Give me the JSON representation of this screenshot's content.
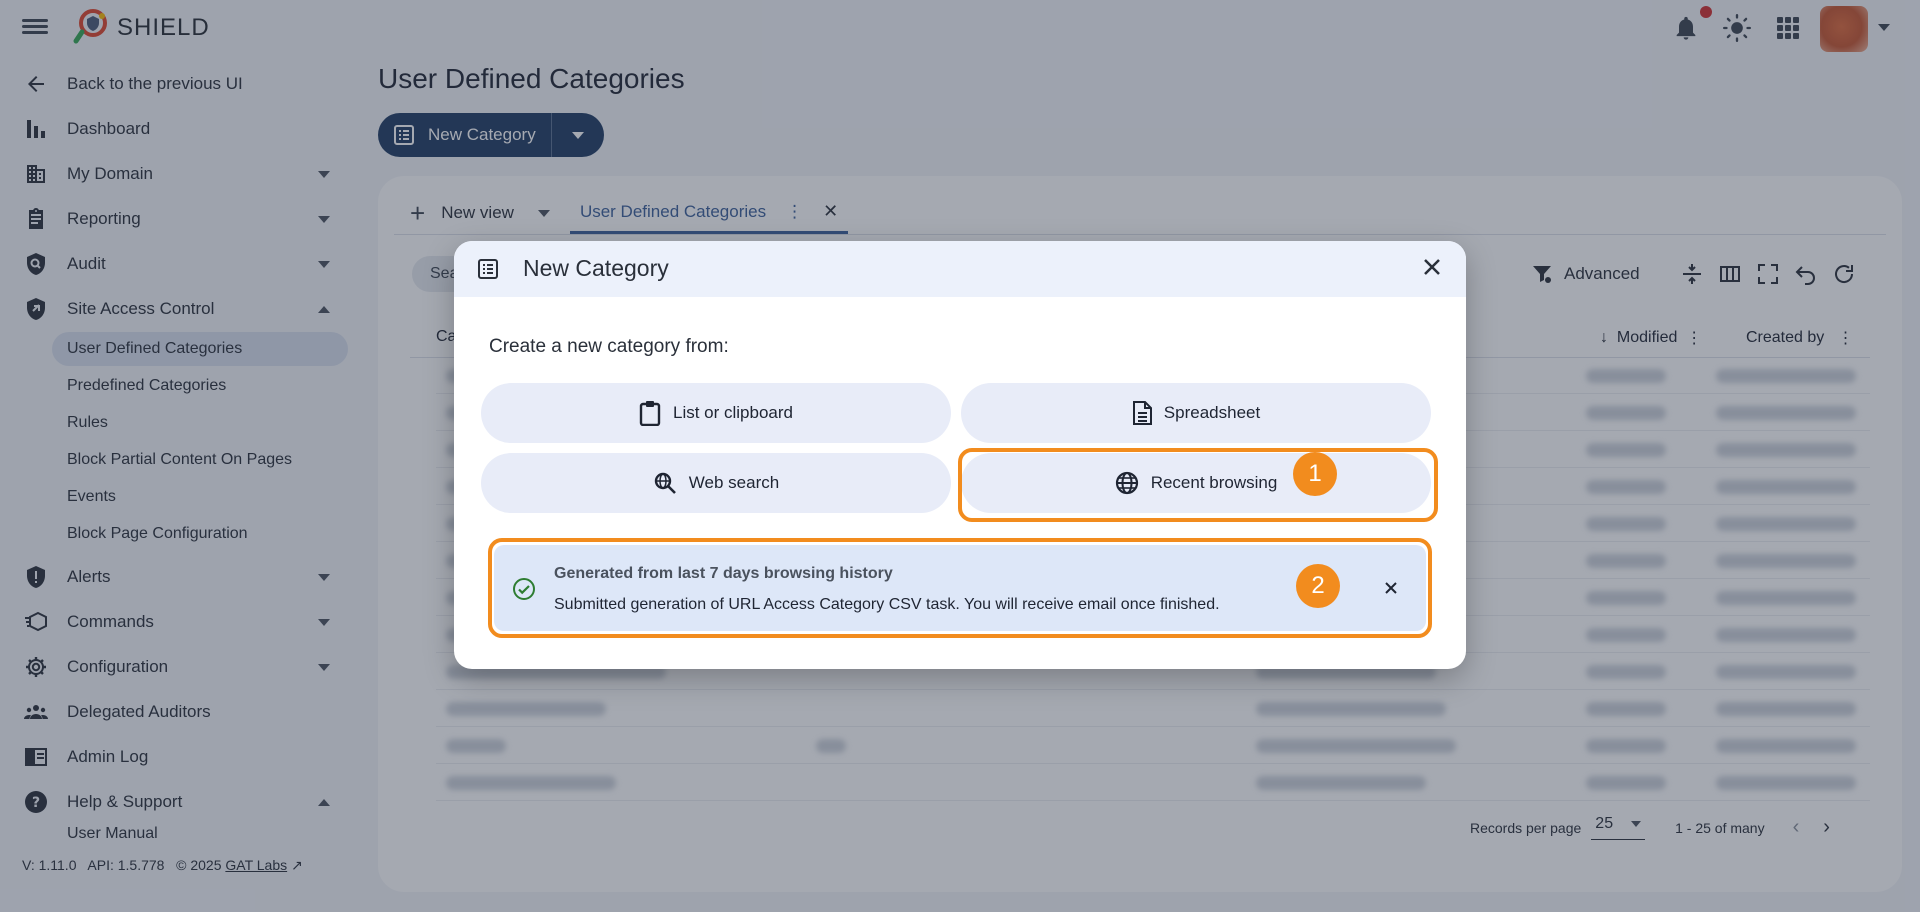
{
  "app": {
    "brand": "SHIELD"
  },
  "sidebar": {
    "back": "Back to the previous UI",
    "items": [
      {
        "label": "Dashboard"
      },
      {
        "label": "My Domain"
      },
      {
        "label": "Reporting"
      },
      {
        "label": "Audit"
      },
      {
        "label": "Site Access Control"
      },
      {
        "label": "Alerts"
      },
      {
        "label": "Commands"
      },
      {
        "label": "Configuration"
      },
      {
        "label": "Delegated Auditors"
      },
      {
        "label": "Admin Log"
      },
      {
        "label": "Help & Support"
      }
    ],
    "sub_items": [
      "User Defined Categories",
      "Predefined Categories",
      "Rules",
      "Block Partial Content On Pages",
      "Events",
      "Block Page Configuration"
    ],
    "help_sub": "User Manual",
    "footer": {
      "version": "V: 1.11.0",
      "api": "API: 1.5.778",
      "copyright": "© 2025",
      "company": "GAT Labs"
    }
  },
  "main": {
    "title": "User Defined Categories",
    "new_button": "New Category",
    "tabs": {
      "new_view": "New view",
      "active": "User Defined Categories"
    },
    "search_placeholder": "Sea",
    "toolbar": {
      "advanced": "Advanced"
    },
    "columns": {
      "first": "Ca",
      "modified": "Modified",
      "created_by": "Created by"
    },
    "pagination": {
      "label": "Records per page",
      "per_page": "25",
      "range": "1 - 25 of many"
    }
  },
  "dialog": {
    "title": "New Category",
    "prompt": "Create a new category from:",
    "options": {
      "list": "List or clipboard",
      "spreadsheet": "Spreadsheet",
      "web": "Web search",
      "recent": "Recent browsing"
    },
    "alert": {
      "title": "Generated from last 7 days browsing history",
      "message": "Submitted generation of URL Access Category CSV task. You will receive email once finished."
    },
    "markers": [
      "1",
      "2"
    ]
  },
  "colors": {
    "accent": "#1f3b63",
    "highlight": "#f28c1e",
    "alert_bg": "#dde7f8",
    "success": "#2e7d32"
  }
}
